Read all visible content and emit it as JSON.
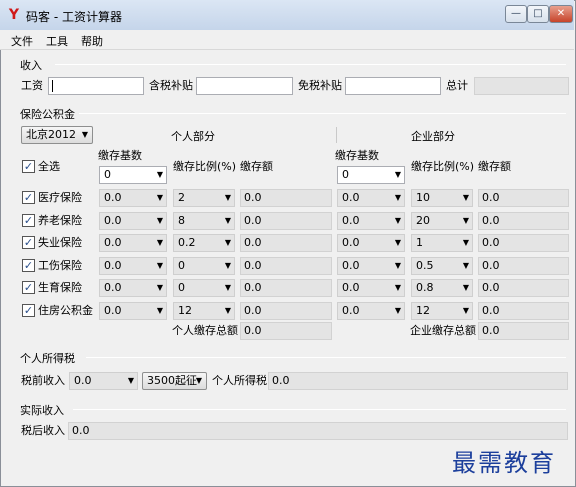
{
  "window": {
    "title": "码客 - 工资计算器",
    "icon_glyph": "Y",
    "min_glyph": "—",
    "max_glyph": "□",
    "close_glyph": "✕"
  },
  "menu": [
    "文件",
    "工具",
    "帮助"
  ],
  "income": {
    "group": "收入",
    "salary_label": "工资",
    "salary_value": "",
    "taxable_allowance_label": "含税补贴",
    "taxable_allowance_value": "",
    "taxfree_allowance_label": "免税补贴",
    "taxfree_allowance_value": "",
    "total_label": "总计",
    "total_value": ""
  },
  "insurance": {
    "group": "保险公积金",
    "city": "北京2012",
    "personal_header": "个人部分",
    "company_header": "企业部分",
    "select_all_label": "全选",
    "base_header": "缴存基数",
    "ratio_header": "缴存比例(%)",
    "amount_header": "缴存额",
    "personal_base_all": "0",
    "company_base_all": "0",
    "rows": [
      {
        "name": "医疗保险",
        "p_base": "0.0",
        "p_ratio": "2",
        "p_amount": "0.0",
        "c_base": "0.0",
        "c_ratio": "10",
        "c_amount": "0.0"
      },
      {
        "name": "养老保险",
        "p_base": "0.0",
        "p_ratio": "8",
        "p_amount": "0.0",
        "c_base": "0.0",
        "c_ratio": "20",
        "c_amount": "0.0"
      },
      {
        "name": "失业保险",
        "p_base": "0.0",
        "p_ratio": "0.2",
        "p_amount": "0.0",
        "c_base": "0.0",
        "c_ratio": "1",
        "c_amount": "0.0"
      },
      {
        "name": "工伤保险",
        "p_base": "0.0",
        "p_ratio": "0",
        "p_amount": "0.0",
        "c_base": "0.0",
        "c_ratio": "0.5",
        "c_amount": "0.0"
      },
      {
        "name": "生育保险",
        "p_base": "0.0",
        "p_ratio": "0",
        "p_amount": "0.0",
        "c_base": "0.0",
        "c_ratio": "0.8",
        "c_amount": "0.0"
      },
      {
        "name": "住房公积金",
        "p_base": "0.0",
        "p_ratio": "12",
        "p_amount": "0.0",
        "c_base": "0.0",
        "c_ratio": "12",
        "c_amount": "0.0"
      }
    ],
    "personal_total_label": "个人缴存总额",
    "personal_total_value": "0.0",
    "company_total_label": "企业缴存总额",
    "company_total_value": "0.0"
  },
  "tax": {
    "group": "个人所得税",
    "pretax_label": "税前收入",
    "pretax_value": "0.0",
    "threshold": "3500起征",
    "tax_label": "个人所得税",
    "tax_value": "0.0"
  },
  "net": {
    "group": "实际收入",
    "aftertax_label": "税后收入",
    "aftertax_value": "0.0"
  },
  "watermark": "最需教育",
  "check_glyph": "✓",
  "arrow_glyph": "▼"
}
